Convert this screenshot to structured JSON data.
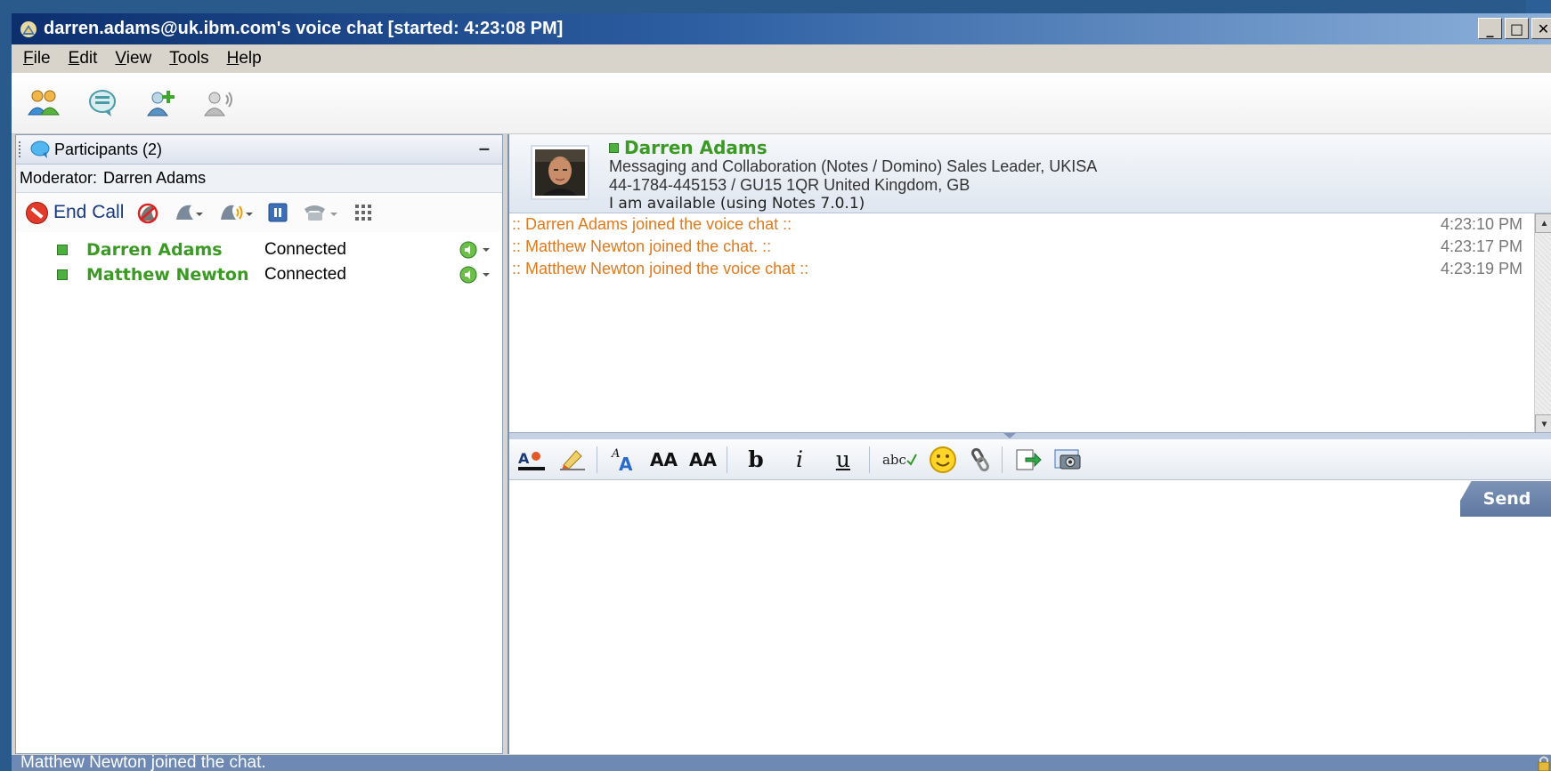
{
  "window": {
    "title": "darren.adams@uk.ibm.com's voice chat [started: 4:23:08 PM]",
    "controls": [
      "_",
      "□",
      "×"
    ]
  },
  "menu": [
    {
      "label": "File",
      "u": "F",
      "rest": "ile"
    },
    {
      "label": "Edit",
      "u": "E",
      "rest": "dit"
    },
    {
      "label": "View",
      "u": "V",
      "rest": "iew"
    },
    {
      "label": "Tools",
      "u": "T",
      "rest": "ools"
    },
    {
      "label": "Help",
      "u": "H",
      "rest": "elp"
    }
  ],
  "toolbar_icons": [
    "people-icon",
    "chat-transcript-icon",
    "add-person-icon",
    "voice-person-icon"
  ],
  "participants": {
    "header": "Participants (2)",
    "moderator_label": "Moderator:",
    "moderator_name": "Darren Adams",
    "end_call_label": "End Call",
    "rows": [
      {
        "name": "Darren Adams",
        "status": "Connected"
      },
      {
        "name": "Matthew Newton",
        "status": "Connected"
      }
    ]
  },
  "business_card": {
    "name": "Darren Adams",
    "title": "Messaging and Collaboration (Notes / Domino) Sales Leader, UKISA",
    "location": "44-1784-445153 / GU15 1QR United Kingdom, GB",
    "availability": "I am available (using Notes 7.0.1)"
  },
  "transcript": [
    {
      "text": ":: Darren Adams joined the voice chat ::",
      "time": "4:23:10 PM"
    },
    {
      "text": ":: Matthew Newton joined the chat. ::",
      "time": "4:23:17 PM"
    },
    {
      "text": ":: Matthew Newton joined the voice chat ::",
      "time": "4:23:19 PM"
    }
  ],
  "format_bar": {
    "bold": "b",
    "italic": "i",
    "underline": "u",
    "grow_font": "AA",
    "shrink_font": "AA",
    "spell": "abc"
  },
  "send_label": "Send",
  "status_text": "Matthew Newton joined the chat.",
  "colors": {
    "online_green": "#3b9a24",
    "system_message": "#e07a1c",
    "titlebar_dark": "#0c2f6e"
  }
}
